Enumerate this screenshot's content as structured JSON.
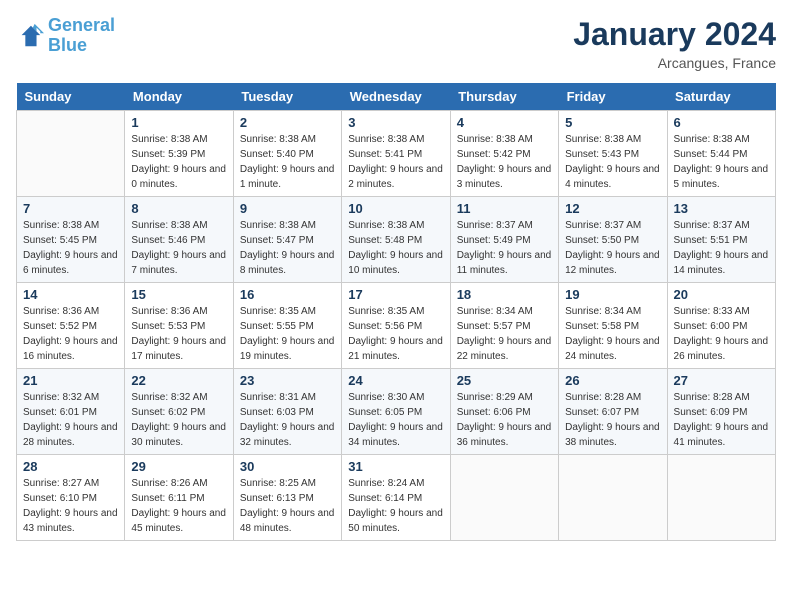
{
  "header": {
    "logo_line1": "General",
    "logo_line2": "Blue",
    "month": "January 2024",
    "location": "Arcangues, France"
  },
  "columns": [
    "Sunday",
    "Monday",
    "Tuesday",
    "Wednesday",
    "Thursday",
    "Friday",
    "Saturday"
  ],
  "weeks": [
    [
      {
        "day": "",
        "sunrise": "",
        "sunset": "",
        "daylight": ""
      },
      {
        "day": "1",
        "sunrise": "Sunrise: 8:38 AM",
        "sunset": "Sunset: 5:39 PM",
        "daylight": "Daylight: 9 hours and 0 minutes."
      },
      {
        "day": "2",
        "sunrise": "Sunrise: 8:38 AM",
        "sunset": "Sunset: 5:40 PM",
        "daylight": "Daylight: 9 hours and 1 minute."
      },
      {
        "day": "3",
        "sunrise": "Sunrise: 8:38 AM",
        "sunset": "Sunset: 5:41 PM",
        "daylight": "Daylight: 9 hours and 2 minutes."
      },
      {
        "day": "4",
        "sunrise": "Sunrise: 8:38 AM",
        "sunset": "Sunset: 5:42 PM",
        "daylight": "Daylight: 9 hours and 3 minutes."
      },
      {
        "day": "5",
        "sunrise": "Sunrise: 8:38 AM",
        "sunset": "Sunset: 5:43 PM",
        "daylight": "Daylight: 9 hours and 4 minutes."
      },
      {
        "day": "6",
        "sunrise": "Sunrise: 8:38 AM",
        "sunset": "Sunset: 5:44 PM",
        "daylight": "Daylight: 9 hours and 5 minutes."
      }
    ],
    [
      {
        "day": "7",
        "sunrise": "Sunrise: 8:38 AM",
        "sunset": "Sunset: 5:45 PM",
        "daylight": "Daylight: 9 hours and 6 minutes."
      },
      {
        "day": "8",
        "sunrise": "Sunrise: 8:38 AM",
        "sunset": "Sunset: 5:46 PM",
        "daylight": "Daylight: 9 hours and 7 minutes."
      },
      {
        "day": "9",
        "sunrise": "Sunrise: 8:38 AM",
        "sunset": "Sunset: 5:47 PM",
        "daylight": "Daylight: 9 hours and 8 minutes."
      },
      {
        "day": "10",
        "sunrise": "Sunrise: 8:38 AM",
        "sunset": "Sunset: 5:48 PM",
        "daylight": "Daylight: 9 hours and 10 minutes."
      },
      {
        "day": "11",
        "sunrise": "Sunrise: 8:37 AM",
        "sunset": "Sunset: 5:49 PM",
        "daylight": "Daylight: 9 hours and 11 minutes."
      },
      {
        "day": "12",
        "sunrise": "Sunrise: 8:37 AM",
        "sunset": "Sunset: 5:50 PM",
        "daylight": "Daylight: 9 hours and 12 minutes."
      },
      {
        "day": "13",
        "sunrise": "Sunrise: 8:37 AM",
        "sunset": "Sunset: 5:51 PM",
        "daylight": "Daylight: 9 hours and 14 minutes."
      }
    ],
    [
      {
        "day": "14",
        "sunrise": "Sunrise: 8:36 AM",
        "sunset": "Sunset: 5:52 PM",
        "daylight": "Daylight: 9 hours and 16 minutes."
      },
      {
        "day": "15",
        "sunrise": "Sunrise: 8:36 AM",
        "sunset": "Sunset: 5:53 PM",
        "daylight": "Daylight: 9 hours and 17 minutes."
      },
      {
        "day": "16",
        "sunrise": "Sunrise: 8:35 AM",
        "sunset": "Sunset: 5:55 PM",
        "daylight": "Daylight: 9 hours and 19 minutes."
      },
      {
        "day": "17",
        "sunrise": "Sunrise: 8:35 AM",
        "sunset": "Sunset: 5:56 PM",
        "daylight": "Daylight: 9 hours and 21 minutes."
      },
      {
        "day": "18",
        "sunrise": "Sunrise: 8:34 AM",
        "sunset": "Sunset: 5:57 PM",
        "daylight": "Daylight: 9 hours and 22 minutes."
      },
      {
        "day": "19",
        "sunrise": "Sunrise: 8:34 AM",
        "sunset": "Sunset: 5:58 PM",
        "daylight": "Daylight: 9 hours and 24 minutes."
      },
      {
        "day": "20",
        "sunrise": "Sunrise: 8:33 AM",
        "sunset": "Sunset: 6:00 PM",
        "daylight": "Daylight: 9 hours and 26 minutes."
      }
    ],
    [
      {
        "day": "21",
        "sunrise": "Sunrise: 8:32 AM",
        "sunset": "Sunset: 6:01 PM",
        "daylight": "Daylight: 9 hours and 28 minutes."
      },
      {
        "day": "22",
        "sunrise": "Sunrise: 8:32 AM",
        "sunset": "Sunset: 6:02 PM",
        "daylight": "Daylight: 9 hours and 30 minutes."
      },
      {
        "day": "23",
        "sunrise": "Sunrise: 8:31 AM",
        "sunset": "Sunset: 6:03 PM",
        "daylight": "Daylight: 9 hours and 32 minutes."
      },
      {
        "day": "24",
        "sunrise": "Sunrise: 8:30 AM",
        "sunset": "Sunset: 6:05 PM",
        "daylight": "Daylight: 9 hours and 34 minutes."
      },
      {
        "day": "25",
        "sunrise": "Sunrise: 8:29 AM",
        "sunset": "Sunset: 6:06 PM",
        "daylight": "Daylight: 9 hours and 36 minutes."
      },
      {
        "day": "26",
        "sunrise": "Sunrise: 8:28 AM",
        "sunset": "Sunset: 6:07 PM",
        "daylight": "Daylight: 9 hours and 38 minutes."
      },
      {
        "day": "27",
        "sunrise": "Sunrise: 8:28 AM",
        "sunset": "Sunset: 6:09 PM",
        "daylight": "Daylight: 9 hours and 41 minutes."
      }
    ],
    [
      {
        "day": "28",
        "sunrise": "Sunrise: 8:27 AM",
        "sunset": "Sunset: 6:10 PM",
        "daylight": "Daylight: 9 hours and 43 minutes."
      },
      {
        "day": "29",
        "sunrise": "Sunrise: 8:26 AM",
        "sunset": "Sunset: 6:11 PM",
        "daylight": "Daylight: 9 hours and 45 minutes."
      },
      {
        "day": "30",
        "sunrise": "Sunrise: 8:25 AM",
        "sunset": "Sunset: 6:13 PM",
        "daylight": "Daylight: 9 hours and 48 minutes."
      },
      {
        "day": "31",
        "sunrise": "Sunrise: 8:24 AM",
        "sunset": "Sunset: 6:14 PM",
        "daylight": "Daylight: 9 hours and 50 minutes."
      },
      {
        "day": "",
        "sunrise": "",
        "sunset": "",
        "daylight": ""
      },
      {
        "day": "",
        "sunrise": "",
        "sunset": "",
        "daylight": ""
      },
      {
        "day": "",
        "sunrise": "",
        "sunset": "",
        "daylight": ""
      }
    ]
  ]
}
